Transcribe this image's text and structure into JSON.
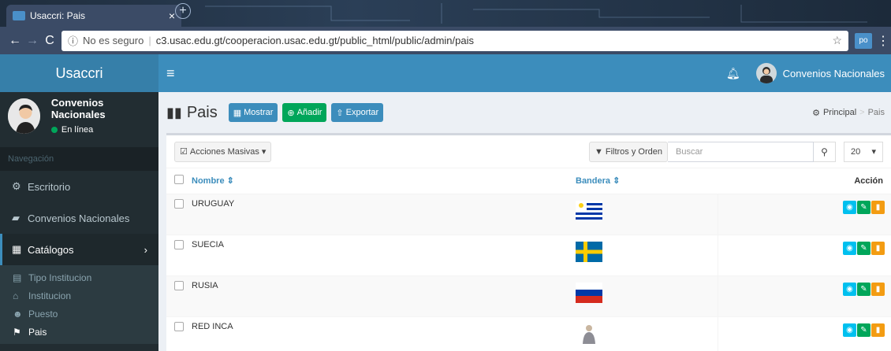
{
  "browser": {
    "tab_title": "Usaccri: Pais",
    "tab_close": "×",
    "new_tab": "+",
    "security_label": "No es seguro",
    "url": "c3.usac.edu.gt/cooperacion.usac.edu.gt/public_html/public/admin/pais",
    "ext_label": "po"
  },
  "app": {
    "logo": "Usaccri",
    "user_name": "Convenios Nacionales"
  },
  "sidebar": {
    "user_name": "Convenios Nacionales",
    "status": "En línea",
    "nav_header": "Navegación",
    "items": [
      {
        "label": "Escritorio"
      },
      {
        "label": "Convenios Nacionales"
      },
      {
        "label": "Catálogos"
      }
    ],
    "subitems": [
      {
        "label": "Tipo Institucion"
      },
      {
        "label": "Institucion"
      },
      {
        "label": "Puesto"
      },
      {
        "label": "Pais"
      }
    ]
  },
  "page": {
    "title": "Pais",
    "btn_mostrar": "Mostrar",
    "btn_anadir": "Añadir",
    "btn_exportar": "Exportar",
    "breadcrumb_home": "Principal",
    "breadcrumb_current": "Pais"
  },
  "toolbar": {
    "bulk_actions": "Acciones Masivas",
    "filters": "Filtros y Orden",
    "search_placeholder": "Buscar",
    "per_page": "20"
  },
  "table": {
    "headers": {
      "nombre": "Nombre",
      "bandera": "Bandera",
      "accion": "Acción"
    },
    "rows": [
      {
        "name": "URUGUAY",
        "flag": "uruguay"
      },
      {
        "name": "SUECIA",
        "flag": "sweden"
      },
      {
        "name": "RUSIA",
        "flag": "russia"
      },
      {
        "name": "RED INCA",
        "flag": "person-photo"
      }
    ]
  },
  "colors": {
    "primary": "#3c8dbc",
    "sidebar": "#222d32",
    "success": "#00a65a",
    "info": "#00c0ef",
    "warning": "#f39c12"
  }
}
